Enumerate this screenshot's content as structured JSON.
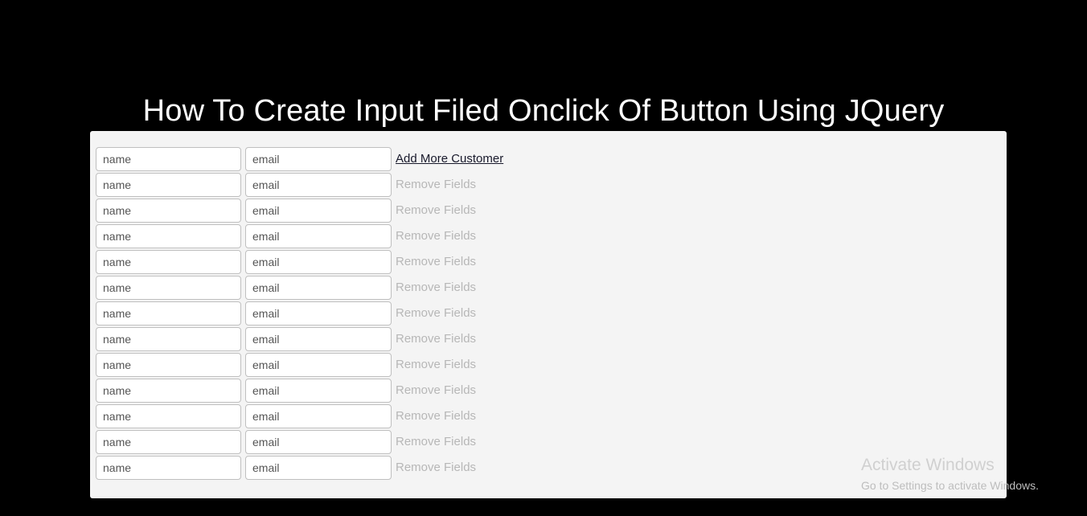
{
  "page": {
    "title": "How To Create Input Filed Onclick Of Button Using JQuery",
    "background_color": "#000000",
    "title_color": "#ffffff"
  },
  "panel": {
    "background_color": "#f4f4f4"
  },
  "form": {
    "name_placeholder": "name",
    "email_placeholder": "email",
    "add_link_label": "Add More Customer",
    "remove_link_label": "Remove Fields",
    "add_link_color": "#18192b",
    "remove_link_color": "#b7b7b7",
    "rows": [
      {
        "name_value": "",
        "email_value": "",
        "action": "Add More Customer",
        "action_type": "add"
      },
      {
        "name_value": "",
        "email_value": "",
        "action": "Remove Fields",
        "action_type": "remove"
      },
      {
        "name_value": "",
        "email_value": "",
        "action": "Remove Fields",
        "action_type": "remove"
      },
      {
        "name_value": "",
        "email_value": "",
        "action": "Remove Fields",
        "action_type": "remove"
      },
      {
        "name_value": "",
        "email_value": "",
        "action": "Remove Fields",
        "action_type": "remove"
      },
      {
        "name_value": "",
        "email_value": "",
        "action": "Remove Fields",
        "action_type": "remove"
      },
      {
        "name_value": "",
        "email_value": "",
        "action": "Remove Fields",
        "action_type": "remove"
      },
      {
        "name_value": "",
        "email_value": "",
        "action": "Remove Fields",
        "action_type": "remove"
      },
      {
        "name_value": "",
        "email_value": "",
        "action": "Remove Fields",
        "action_type": "remove"
      },
      {
        "name_value": "",
        "email_value": "",
        "action": "Remove Fields",
        "action_type": "remove"
      },
      {
        "name_value": "",
        "email_value": "",
        "action": "Remove Fields",
        "action_type": "remove"
      },
      {
        "name_value": "",
        "email_value": "",
        "action": "Remove Fields",
        "action_type": "remove"
      },
      {
        "name_value": "",
        "email_value": "",
        "action": "Remove Fields",
        "action_type": "remove"
      }
    ]
  },
  "watermark": {
    "title": "Activate Windows",
    "subtitle": "Go to Settings to activate Windows."
  }
}
